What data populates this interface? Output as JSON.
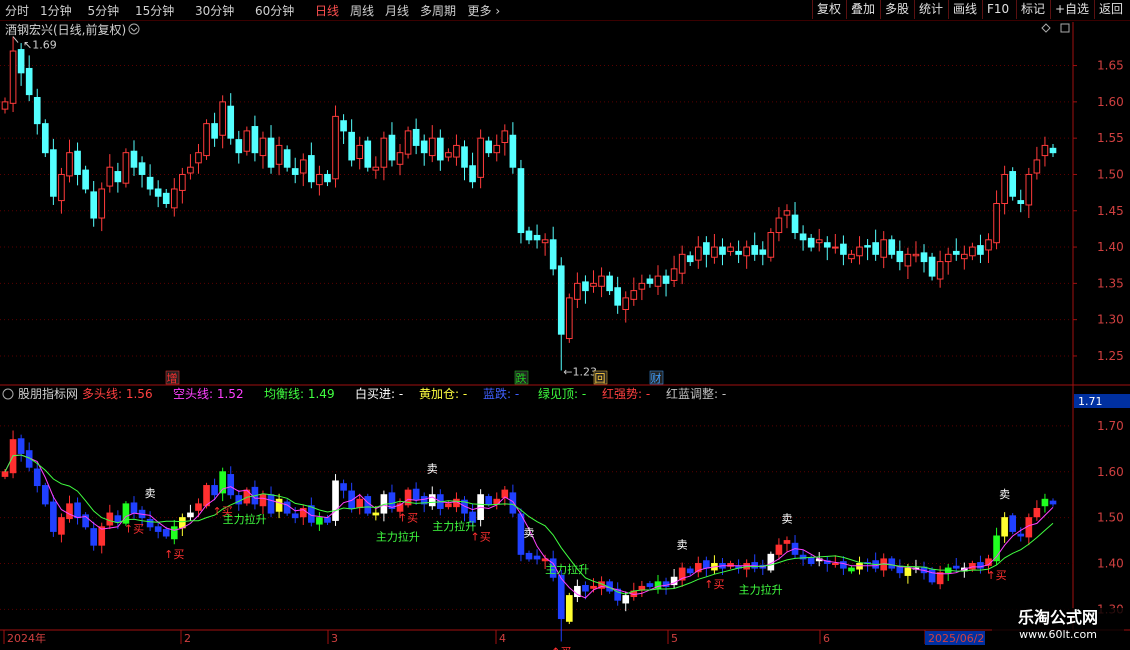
{
  "toolbar": {
    "left": [
      "分时",
      "1分钟",
      "5分钟",
      "15分钟",
      "30分钟",
      "60分钟",
      "日线",
      "周线",
      "月线",
      "多周期",
      "更多"
    ],
    "more_icon": "chevron-right-icon",
    "active": "日线",
    "right": [
      "复权",
      "叠加",
      "多股",
      "统计",
      "画线",
      "F10",
      "标记",
      "+自选",
      "返回"
    ]
  },
  "main_chart": {
    "title": "酒钢宏兴(日线,前复权)",
    "title_icon": "chevron-down-circle-icon",
    "corner_icons": [
      "diamond-icon",
      "square-icon"
    ],
    "y_ticks": [
      "1.65",
      "1.60",
      "1.55",
      "1.50",
      "1.45",
      "1.40",
      "1.35",
      "1.30",
      "1.25"
    ],
    "high_label": "1.69",
    "low_label": "1.23",
    "event_badges": [
      {
        "text": "增",
        "color": "#ff3030"
      },
      {
        "text": "跌",
        "color": "#20d020"
      },
      {
        "text": "回",
        "color": "#ffcc40"
      },
      {
        "text": "财",
        "color": "#40a0ff"
      }
    ]
  },
  "indicator": {
    "name": "股朋指标网",
    "fields": [
      {
        "label": "多头线:",
        "value": "1.56",
        "color": "#ff4040"
      },
      {
        "label": "空头线:",
        "value": "1.52",
        "color": "#ff40ff"
      },
      {
        "label": "均衡线:",
        "value": "1.49",
        "color": "#40ff40"
      },
      {
        "label": "白买进:",
        "value": "-",
        "color": "#ffffff"
      },
      {
        "label": "黄加仓:",
        "value": "-",
        "color": "#ffff40"
      },
      {
        "label": "蓝跌:",
        "value": "-",
        "color": "#4060ff"
      },
      {
        "label": "绿见顶:",
        "value": "-",
        "color": "#40ff40"
      },
      {
        "label": "红强势:",
        "value": "-",
        "color": "#ff4040"
      },
      {
        "label": "红蓝调整:",
        "value": "-",
        "color": "#c0c0c0"
      }
    ],
    "y_ticks": [
      "1.70",
      "1.60",
      "1.50",
      "1.40",
      "1.30"
    ],
    "current_value": "1.71",
    "signals": {
      "sell": "卖",
      "buy": "买",
      "lift": "主力拉升"
    }
  },
  "x_axis": {
    "labels": [
      "2024年",
      "2",
      "3",
      "4",
      "5",
      "6",
      "2025/06/2"
    ]
  },
  "colors": {
    "up": "#ff3b3b",
    "down": "#54ffff",
    "grid": "#5a0000",
    "axis": "#a01010"
  },
  "watermark": {
    "line1": "乐淘公式网",
    "line2": "www.60lt.com"
  },
  "chart_data": {
    "type": "candlestick",
    "title": "酒钢宏兴(日线,前复权)",
    "ylim": [
      1.21,
      1.71
    ],
    "close": [
      1.6,
      1.67,
      1.64,
      1.61,
      1.57,
      1.53,
      1.47,
      1.5,
      1.53,
      1.5,
      1.48,
      1.44,
      1.48,
      1.51,
      1.49,
      1.53,
      1.51,
      1.5,
      1.48,
      1.47,
      1.46,
      1.48,
      1.5,
      1.51,
      1.53,
      1.57,
      1.55,
      1.6,
      1.55,
      1.53,
      1.56,
      1.53,
      1.55,
      1.51,
      1.54,
      1.51,
      1.5,
      1.52,
      1.49,
      1.5,
      1.49,
      1.58,
      1.56,
      1.52,
      1.54,
      1.51,
      1.51,
      1.55,
      1.52,
      1.53,
      1.56,
      1.54,
      1.53,
      1.55,
      1.52,
      1.53,
      1.54,
      1.51,
      1.49,
      1.55,
      1.53,
      1.54,
      1.56,
      1.51,
      1.42,
      1.41,
      1.41,
      1.41,
      1.37,
      1.28,
      1.33,
      1.35,
      1.34,
      1.35,
      1.36,
      1.34,
      1.32,
      1.33,
      1.34,
      1.35,
      1.35,
      1.36,
      1.35,
      1.37,
      1.39,
      1.38,
      1.4,
      1.39,
      1.4,
      1.39,
      1.4,
      1.39,
      1.4,
      1.39,
      1.39,
      1.42,
      1.44,
      1.45,
      1.42,
      1.41,
      1.4,
      1.41,
      1.4,
      1.4,
      1.39,
      1.39,
      1.4,
      1.4,
      1.39,
      1.41,
      1.39,
      1.38,
      1.39,
      1.39,
      1.38,
      1.36,
      1.38,
      1.39,
      1.39,
      1.39,
      1.4,
      1.39,
      1.41,
      1.46,
      1.5,
      1.47,
      1.46,
      1.5,
      1.52,
      1.54,
      1.53
    ],
    "open_prev_close": true,
    "x_labels": [
      "2024年",
      "2",
      "3",
      "4",
      "5",
      "6",
      "2025/06/2"
    ]
  }
}
